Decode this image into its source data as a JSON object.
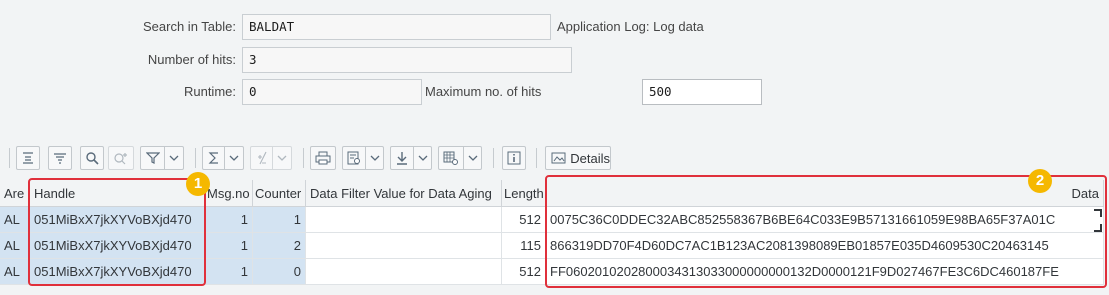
{
  "form": {
    "search_in_table_label": "Search in Table:",
    "search_in_table_value": "BALDAT",
    "table_description": "Application Log: Log data",
    "number_of_hits_label": "Number of hits:",
    "number_of_hits_value": "3",
    "runtime_label": "Runtime:",
    "runtime_value": "0",
    "max_hits_label": "Maximum no. of hits",
    "max_hits_value": "500"
  },
  "toolbar": {
    "details_label": "Details",
    "icons": [
      "align-top-icon",
      "filter-lines-icon",
      "search-icon",
      "search-next-icon",
      "filter-icon",
      "sum-icon",
      "subtotal-icon",
      "print-icon",
      "view-icon",
      "export-icon",
      "layout-icon",
      "info-icon",
      "details-icon"
    ]
  },
  "grid": {
    "columns": [
      "Are",
      "Handle",
      "Msg.no",
      "Counter",
      "Data Filter Value for Data Aging",
      "Length",
      "Data"
    ],
    "rows": [
      {
        "area": "AL",
        "handle": "051MiBxX7jkXYVoBXjd470",
        "msgno": "1",
        "counter": "1",
        "filter": "",
        "length": "512",
        "data": "0075C36C0DDEC32ABC852558367B6BE64C033E9B57131661059E98BA65F37A01C"
      },
      {
        "area": "AL",
        "handle": "051MiBxX7jkXYVoBXjd470",
        "msgno": "1",
        "counter": "2",
        "filter": "",
        "length": "115",
        "data": "866319DD70F4D60DC7AC1B123AC2081398089EB01857E035D4609530C20463145"
      },
      {
        "area": "AL",
        "handle": "051MiBxX7jkXYVoBXjd470",
        "msgno": "1",
        "counter": "0",
        "filter": "",
        "length": "512",
        "data": "FF0602010202800034313033000000000132D0000121F9D027467FE3C6DC460187FE"
      }
    ]
  },
  "annotations": {
    "badge_1": "1",
    "badge_2": "2"
  },
  "colors": {
    "annotation_red": "#e0303b",
    "badge_yellow": "#f5b800",
    "key_cell_blue": "#d3e3f2"
  }
}
